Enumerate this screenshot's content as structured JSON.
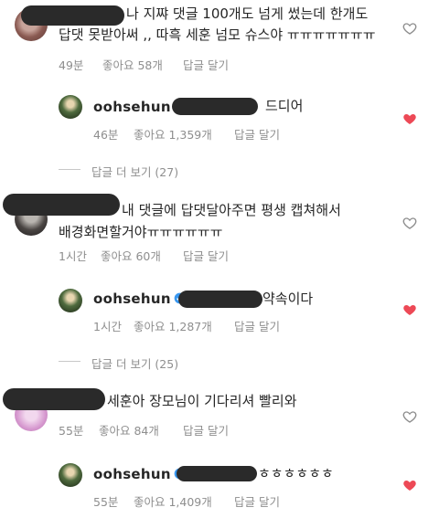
{
  "comments": [
    {
      "id": "c1",
      "line1": "나 지쨔 댓글 100개도 넘게 썼는데 한개도",
      "line2": "답댓 못받아써 ,, 따흑 세훈 넘모 슈스야 ㅠㅠㅠㅠㅠㅠㅠ",
      "time": "49분",
      "likes": "좋아요 58개",
      "reply": "답글 달기",
      "liked": false,
      "reply_item": {
        "username": "oohsehun",
        "text": "드디어",
        "time": "46분",
        "likes": "좋아요 1,359개",
        "reply": "답글 달기",
        "liked": true
      },
      "more_replies": "답글 더 보기 (27)"
    },
    {
      "id": "c2",
      "line1": "내 댓글에 답댓달아주면 평생 캡쳐해서",
      "line2": "배경화면할거야ㅠㅠㅠㅠㅠㅠ",
      "time": "1시간",
      "likes": "좋아요 60개",
      "reply": "답글 달기",
      "liked": false,
      "reply_item": {
        "username": "oohsehun",
        "text": "약속이다",
        "time": "1시간",
        "likes": "좋아요 1,287개",
        "reply": "답글 달기",
        "liked": true
      },
      "more_replies": "답글 더 보기 (25)"
    },
    {
      "id": "c3",
      "line1": "세훈아 장모님이 기다리셔 빨리와",
      "time": "55분",
      "likes": "좋아요 84개",
      "reply": "답글 달기",
      "liked": false,
      "reply_item": {
        "username": "oohsehun",
        "text": "ㅎㅎㅎㅎㅎㅎ",
        "time": "55분",
        "likes": "좋아요 1,409개",
        "reply": "답글 달기",
        "liked": true
      }
    }
  ],
  "colors": {
    "heart_liked": "#ed4956",
    "heart_outline": "#8e8e8e",
    "verified": "#3897f0",
    "meta_text": "#8e8e8e"
  },
  "icons": {
    "like": "heart-icon",
    "verified": "verified-badge-icon"
  }
}
